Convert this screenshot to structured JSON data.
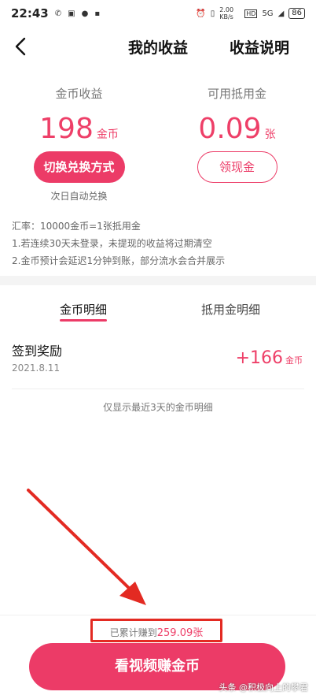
{
  "status_bar": {
    "time": "22:43",
    "network_speed": "2.00 KB/s",
    "signal": "5G",
    "battery": "86",
    "icons": [
      "notification-icon",
      "app-icon",
      "chat-icon",
      "message-icon",
      "alarm-icon",
      "vibrate-icon",
      "hd-icon",
      "wifi-icon"
    ]
  },
  "nav": {
    "title": "我的收益",
    "right_link": "收益说明"
  },
  "earnings": {
    "coins_label": "金币收益",
    "coins_value": "198",
    "coins_unit": "金币",
    "switch_button": "切换兑换方式",
    "auto_note": "次日自动兑换",
    "voucher_label": "可用抵用金",
    "voucher_value": "0.09",
    "voucher_unit": "张",
    "withdraw_button": "领现金"
  },
  "rules": {
    "rate": "汇率：10000金币=1张抵用金",
    "rule1": "1.若连续30天未登录，未提现的收益将过期清空",
    "rule2": "2.金币预计会延迟1分钟到账，部分流水会合并展示"
  },
  "tabs": [
    {
      "label": "金币明细",
      "active": true
    },
    {
      "label": "抵用金明细",
      "active": false
    }
  ],
  "records": [
    {
      "title": "签到奖励",
      "date": "2021.8.11",
      "amount": "+166",
      "unit": "金币"
    }
  ],
  "notice": "仅显示最近3天的金币明细",
  "bottom": {
    "cumulative_prefix": "已累计赚到",
    "cumulative_value": "259.09张",
    "cta_label": "看视频赚金币"
  },
  "watermark": "头条 @积极向上的攀君",
  "colors": {
    "accent": "#ec3b67",
    "highlight_box": "#e32a22"
  }
}
